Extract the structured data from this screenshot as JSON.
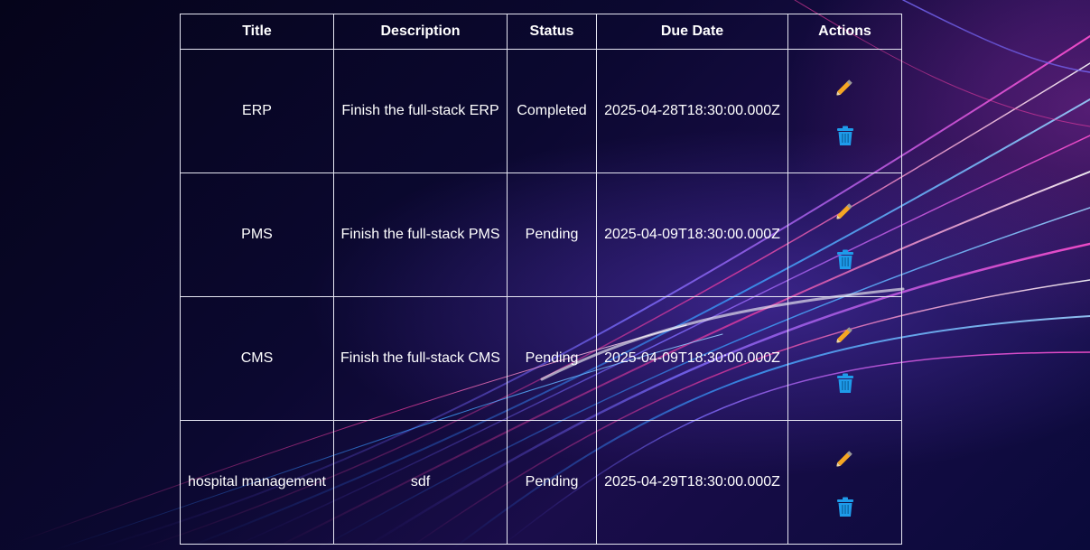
{
  "table": {
    "headers": {
      "title": "Title",
      "description": "Description",
      "status": "Status",
      "due_date": "Due Date",
      "actions": "Actions"
    },
    "rows": [
      {
        "title": "ERP",
        "description": "Finish the full-stack ERP",
        "status": "Completed",
        "due_date": "2025-04-28T18:30:00.000Z"
      },
      {
        "title": "PMS",
        "description": "Finish the full-stack PMS",
        "status": "Pending",
        "due_date": "2025-04-09T18:30:00.000Z"
      },
      {
        "title": "CMS",
        "description": "Finish the full-stack CMS",
        "status": "Pending",
        "due_date": "2025-04-09T18:30:00.000Z"
      },
      {
        "title": "hospital management",
        "description": "sdf",
        "status": "Pending",
        "due_date": "2025-04-29T18:30:00.000Z"
      }
    ]
  },
  "icons": {
    "edit": "pencil-icon",
    "delete": "trash-icon"
  },
  "colors": {
    "pencil": "#f5a623",
    "trash": "#1e9bea",
    "border": "#e6e6f2"
  }
}
